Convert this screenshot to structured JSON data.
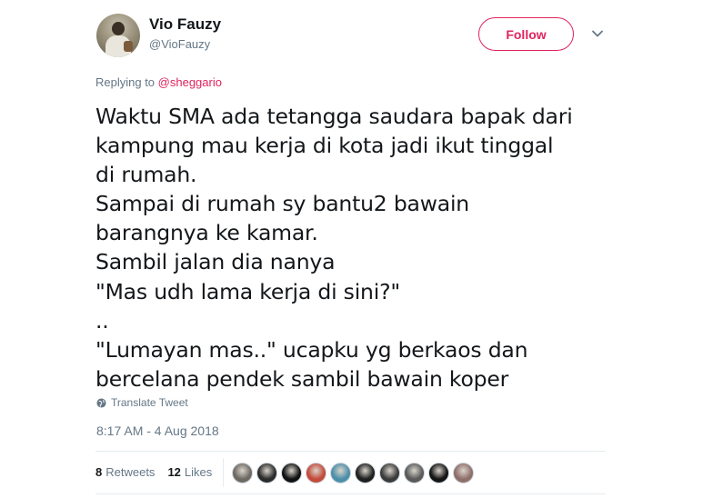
{
  "user": {
    "display_name": "Vio Fauzy",
    "handle": "@VioFauzy",
    "avatar_icon": "user-avatar-photo"
  },
  "follow_button": {
    "label": "Follow",
    "color": "#e0245e"
  },
  "menu_icon": "chevron-down-icon",
  "reply": {
    "prefix": "Replying to ",
    "mention": "@sheggario"
  },
  "tweet_text": "Waktu SMA ada tetangga saudara bapak dari\nkampung mau kerja di kota jadi ikut tinggal\ndi rumah.\nSampai di rumah sy bantu2 bawain\nbarangnya ke kamar.\nSambil jalan dia nanya\n\"Mas udh lama kerja di sini?\"\n..\n\"Lumayan mas..\" ucapku yg berkaos dan\nbercelana pendek sambil bawain koper",
  "translate": {
    "label": "Translate Tweet",
    "icon": "globe-icon"
  },
  "timestamp": "8:17 AM - 4 Aug 2018",
  "stats": {
    "retweets_count": "8",
    "retweets_label": "Retweets",
    "likes_count": "12",
    "likes_label": "Likes"
  },
  "liker_avatars": [
    {
      "name": "liker-avatar-1",
      "color": "#6e6a63"
    },
    {
      "name": "liker-avatar-2",
      "color": "#2b2b2b"
    },
    {
      "name": "liker-avatar-3",
      "color": "#111111"
    },
    {
      "name": "liker-avatar-4",
      "color": "#c44b3b"
    },
    {
      "name": "liker-avatar-5",
      "color": "#4d8fa8"
    },
    {
      "name": "liker-avatar-6",
      "color": "#1f1f1f"
    },
    {
      "name": "liker-avatar-7",
      "color": "#3b3b3b"
    },
    {
      "name": "liker-avatar-8",
      "color": "#5a5a5a"
    },
    {
      "name": "liker-avatar-9",
      "color": "#141414"
    },
    {
      "name": "liker-avatar-10",
      "color": "#8f6f6a"
    }
  ]
}
